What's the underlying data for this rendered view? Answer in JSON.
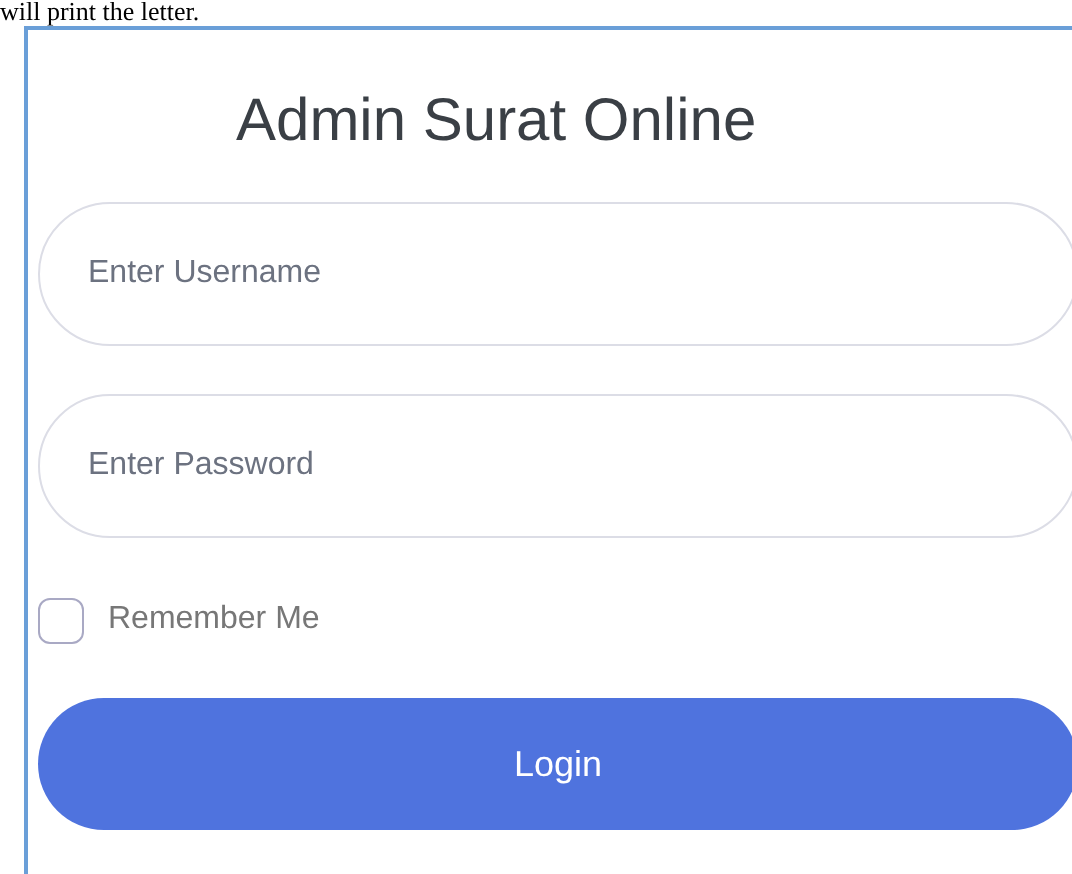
{
  "page_text": "will print the letter.",
  "login_form": {
    "title": "Admin Surat Online",
    "fields": [
      {
        "placeholder": "Enter Username"
      },
      {
        "placeholder": "Enter Password"
      }
    ],
    "remember": {
      "label": "Remember Me",
      "checked": false
    },
    "submit": "Login"
  }
}
